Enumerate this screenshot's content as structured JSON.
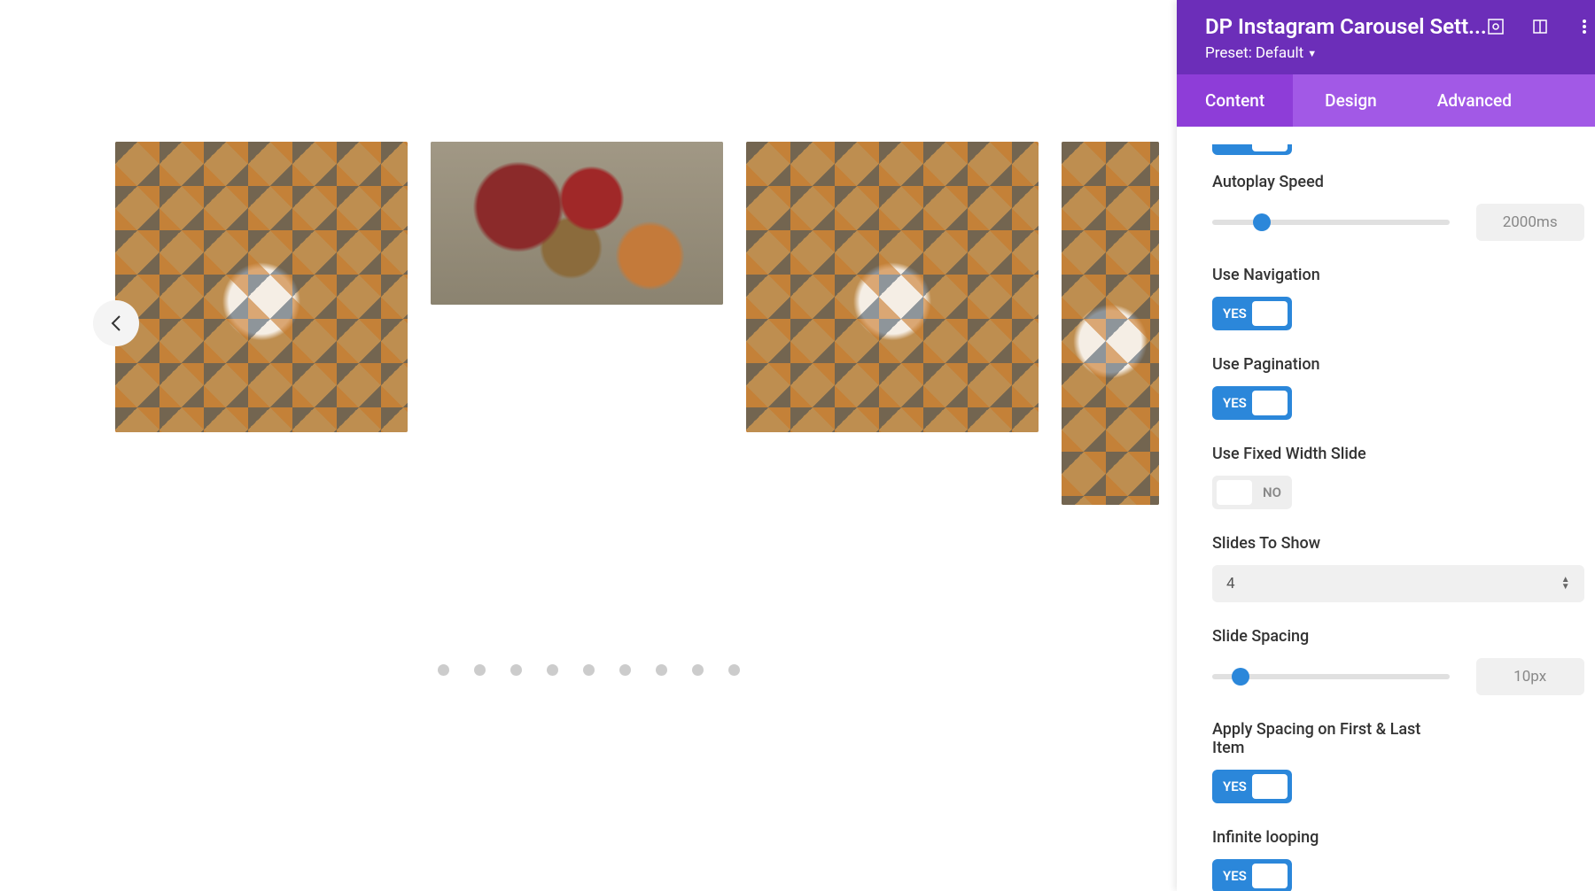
{
  "panel": {
    "title": "DP Instagram Carousel Sett...",
    "preset_label": "Preset:",
    "preset_value": "Default"
  },
  "tabs": {
    "content": "Content",
    "design": "Design",
    "advanced": "Advanced"
  },
  "settings": {
    "autoplay_speed": {
      "label": "Autoplay Speed",
      "value": "2000ms"
    },
    "use_navigation": {
      "label": "Use Navigation",
      "value": "YES"
    },
    "use_pagination": {
      "label": "Use Pagination",
      "value": "YES"
    },
    "use_fixed_width": {
      "label": "Use Fixed Width Slide",
      "value": "NO"
    },
    "slides_to_show": {
      "label": "Slides To Show",
      "value": "4"
    },
    "slide_spacing": {
      "label": "Slide Spacing",
      "value": "10px"
    },
    "apply_spacing": {
      "label": "Apply Spacing on First & Last Item",
      "value": "YES"
    },
    "infinite_looping": {
      "label": "Infinite looping",
      "value": "YES"
    }
  },
  "icons": {
    "expand": "expand",
    "responsive": "responsive",
    "more": "more"
  }
}
